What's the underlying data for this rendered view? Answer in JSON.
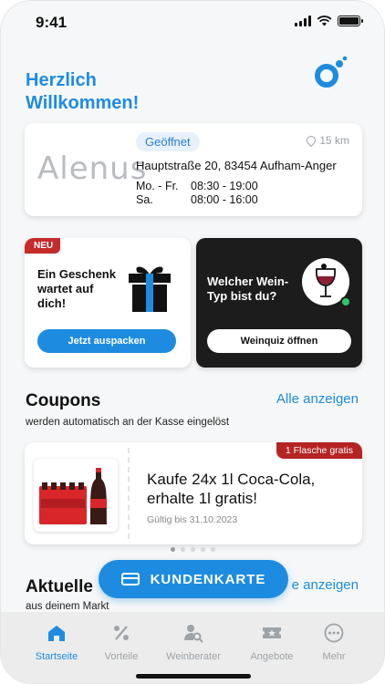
{
  "status_bar": {
    "time": "9:41"
  },
  "header": {
    "welcome_line1": "Herzlich",
    "welcome_line2": "Willkommen!"
  },
  "store": {
    "logo_text": "Alenus",
    "status": "Geöffnet",
    "distance": "15 km",
    "address": "Hauptstraße 20, 83454 Aufham-Anger",
    "hours": [
      {
        "days": "Mo. - Fr.",
        "time": "08:30 - 19:00"
      },
      {
        "days": "Sa.",
        "time": "08:00 - 16:00"
      }
    ]
  },
  "gift_card": {
    "badge": "NEU",
    "text": "Ein Geschenk wartet auf dich!",
    "button": "Jetzt auspacken"
  },
  "wine_card": {
    "text": "Welcher Wein-Typ bist du?",
    "button": "Weinquiz öffnen"
  },
  "coupons": {
    "title": "Coupons",
    "subtitle": "werden automatisch an der Kasse eingelöst",
    "link": "Alle anzeigen",
    "item": {
      "badge": "1 Flasche gratis",
      "title": "Kaufe 24x 1l Coca-Cola, erhalte 1l gratis!",
      "valid": "Gültig bis 31.10.2023"
    },
    "pagination": {
      "count": 5,
      "active_index": 0
    }
  },
  "current": {
    "title": "Aktuelle",
    "subtitle": "aus deinem Markt",
    "link": "e anzeigen"
  },
  "customer_card_button": "KUNDENKARTE",
  "bottom_nav": [
    {
      "label": "Startseite",
      "icon": "home-icon",
      "active": true
    },
    {
      "label": "Vorteile",
      "icon": "percent-icon",
      "active": false
    },
    {
      "label": "Weinberater",
      "icon": "person-search-icon",
      "active": false
    },
    {
      "label": "Angebote",
      "icon": "ticket-star-icon",
      "active": false
    },
    {
      "label": "Mehr",
      "icon": "more-icon",
      "active": false
    }
  ],
  "colors": {
    "accent": "#1d8ce0",
    "badge_red": "#c52b2b",
    "dark_card": "#1c1c1c"
  }
}
